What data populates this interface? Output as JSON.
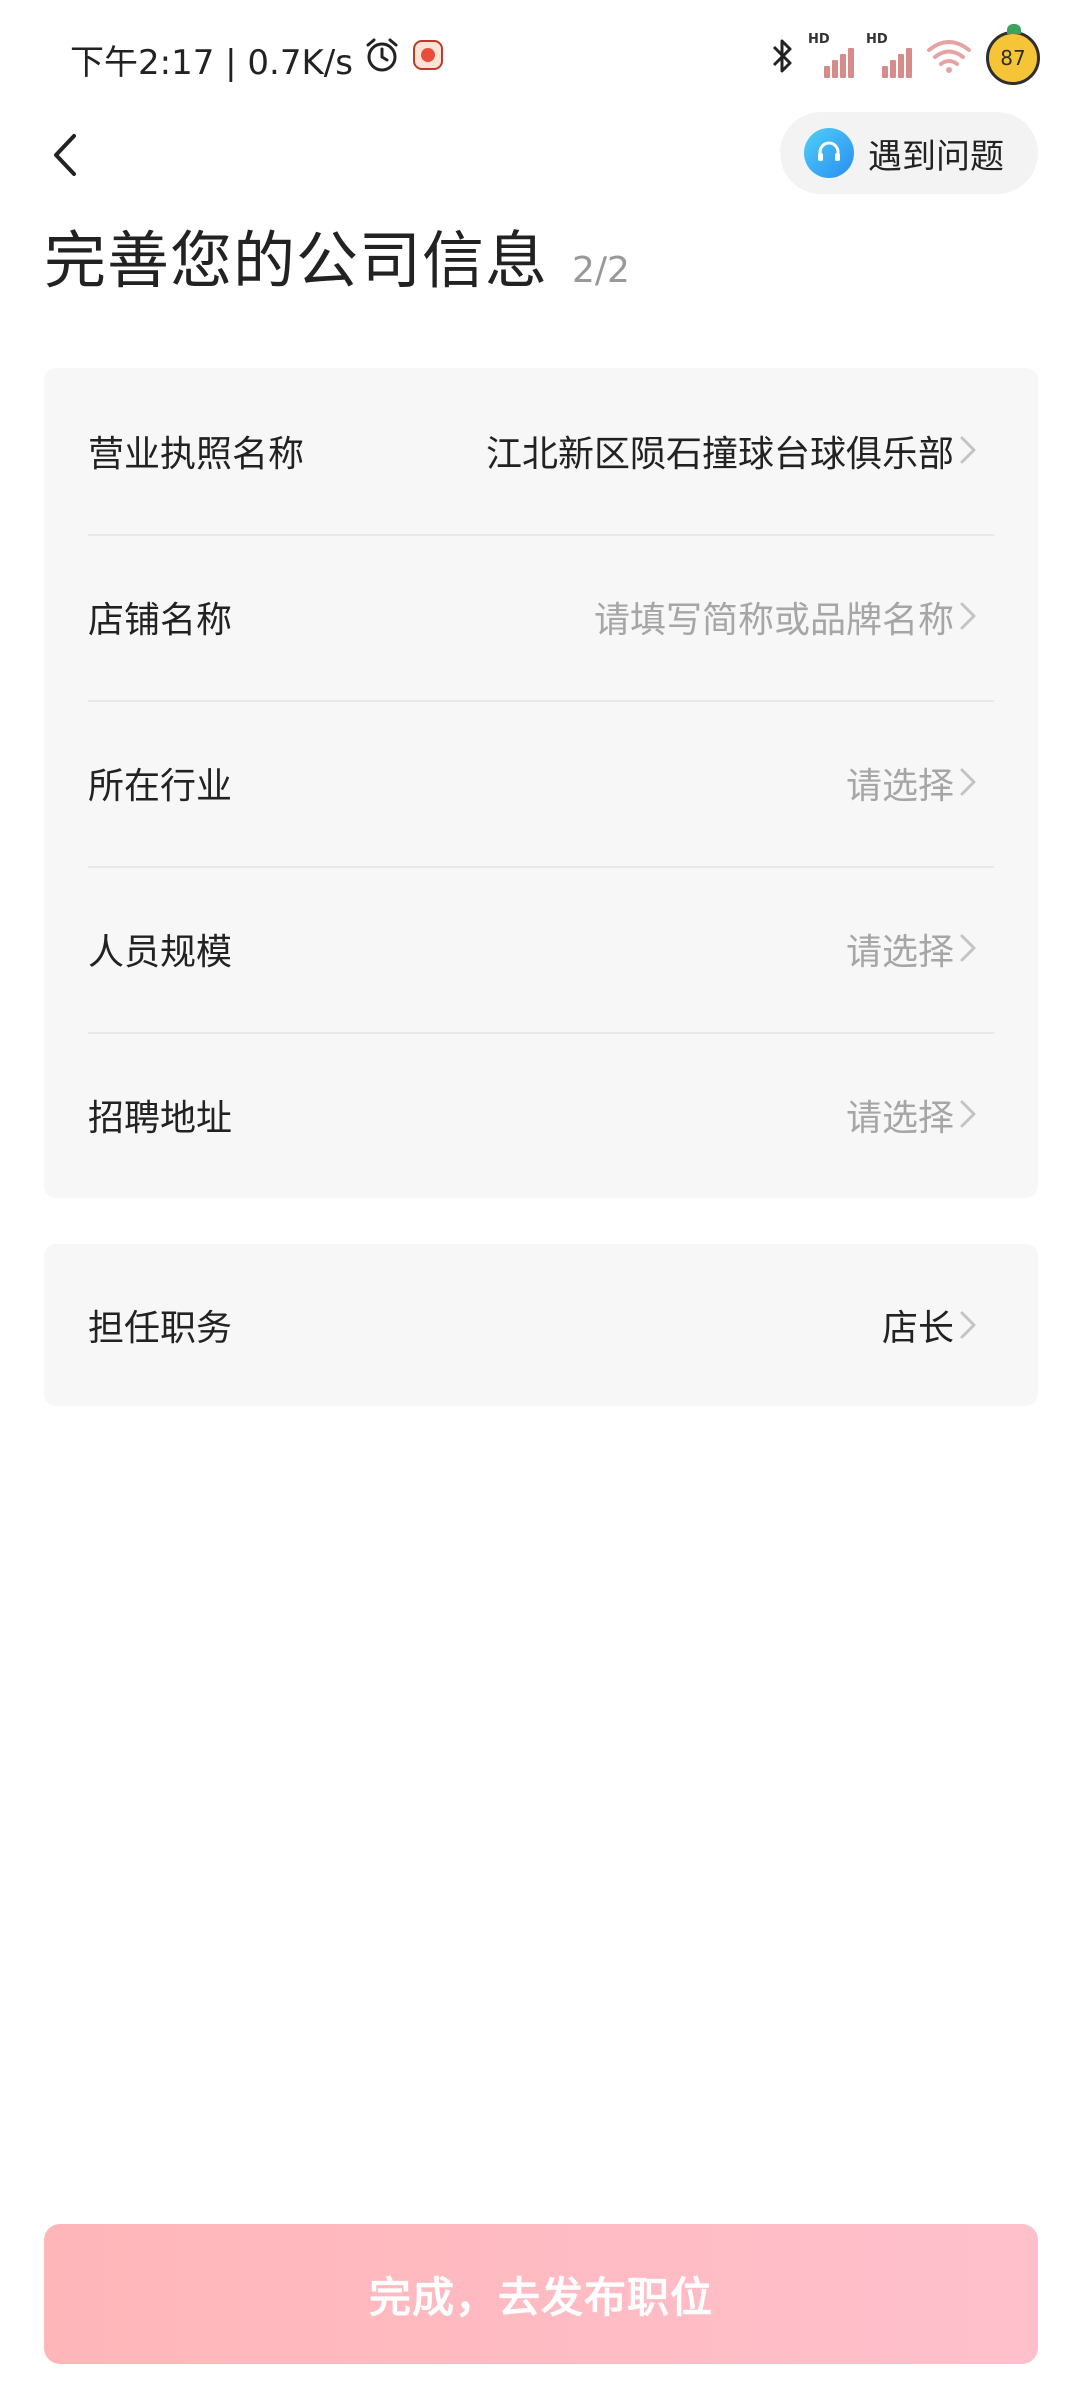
{
  "status_bar": {
    "time_speed": "下午2:17 | 0.7K/s",
    "battery": "87",
    "hd_label_1": "HD",
    "hd_label_2": "HD",
    "icons": [
      "alarm-icon",
      "app-notification-icon",
      "bluetooth-icon",
      "signal-icon",
      "signal-icon",
      "wifi-icon",
      "battery-icon"
    ]
  },
  "header": {
    "help_label": "遇到问题",
    "title": "完善您的公司信息",
    "step": "2/2"
  },
  "form": {
    "rows": [
      {
        "label": "营业执照名称",
        "value": "江北新区陨石撞球台球俱乐部",
        "is_placeholder": false
      },
      {
        "label": "店铺名称",
        "value": "请填写简称或品牌名称",
        "is_placeholder": true
      },
      {
        "label": "所在行业",
        "value": "请选择",
        "is_placeholder": true
      },
      {
        "label": "人员规模",
        "value": "请选择",
        "is_placeholder": true
      },
      {
        "label": "招聘地址",
        "value": "请选择",
        "is_placeholder": true
      }
    ],
    "position_row": {
      "label": "担任职务",
      "value": "店长",
      "is_placeholder": false
    }
  },
  "submit": {
    "label": "完成，去发布职位"
  },
  "colors": {
    "accent_button_start": "#ffb6b9",
    "accent_button_end": "#ffc0cc",
    "help_icon": "#2a8df2",
    "placeholder_text": "#a6a6a6",
    "card_bg": "#f7f7f7"
  }
}
